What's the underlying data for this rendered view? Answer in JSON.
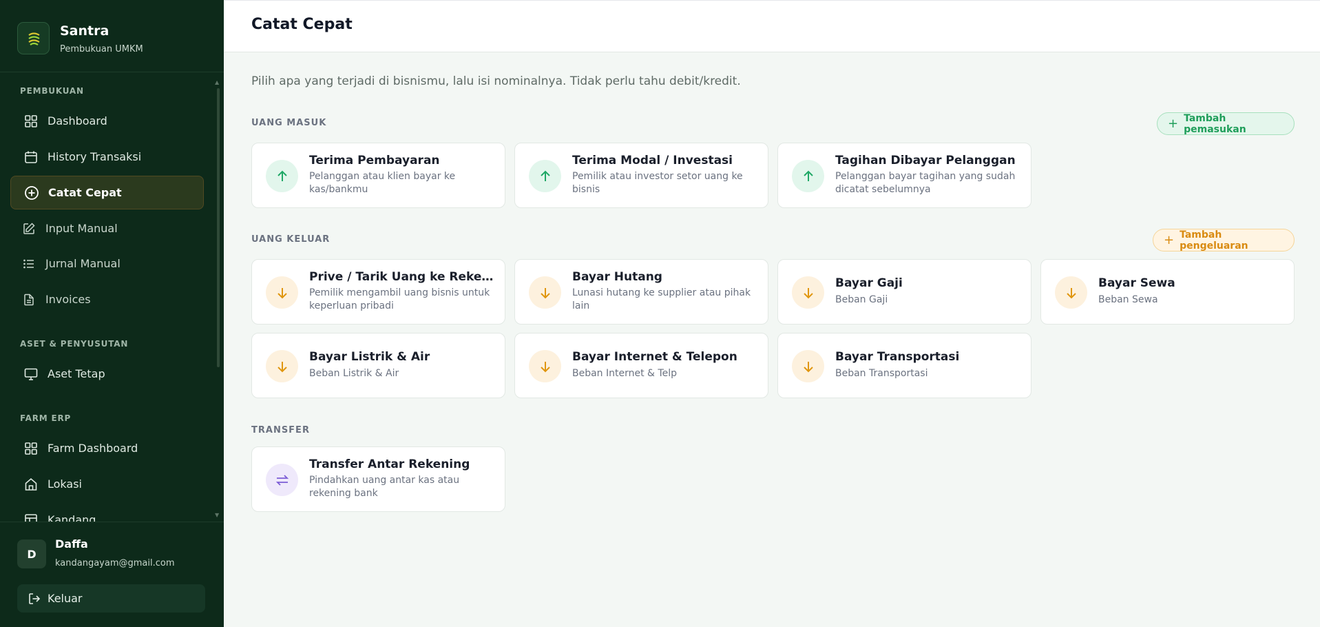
{
  "brand": {
    "name": "Santra",
    "subtitle": "Pembukuan UMKM"
  },
  "sidebar": {
    "sections": [
      {
        "label": "PEMBUKUAN"
      },
      {
        "label": "ASET & PENYUSUTAN"
      },
      {
        "label": "FARM ERP"
      }
    ],
    "items": [
      {
        "label": "Dashboard",
        "icon": "grid-icon"
      },
      {
        "label": "History Transaksi",
        "icon": "calendar-icon"
      },
      {
        "label": "Catat Cepat",
        "icon": "plus-circle-icon",
        "active": true
      },
      {
        "label": "Input Manual",
        "icon": "edit-icon"
      },
      {
        "label": "Jurnal Manual",
        "icon": "list-icon"
      },
      {
        "label": "Invoices",
        "icon": "file-icon"
      },
      {
        "label": "Aset Tetap",
        "icon": "monitor-icon"
      },
      {
        "label": "Farm Dashboard",
        "icon": "grid-icon"
      },
      {
        "label": "Lokasi",
        "icon": "home-icon"
      },
      {
        "label": "Kandang",
        "icon": "layout-icon"
      }
    ]
  },
  "user": {
    "initial": "D",
    "name": "Daffa",
    "email": "kandangayam@gmail.com",
    "logout_label": "Keluar"
  },
  "header": {
    "title": "Catat Cepat"
  },
  "intro": "Pilih apa yang terjadi di bisnismu, lalu isi nominalnya. Tidak perlu tahu debit/kredit.",
  "sections": {
    "masuk": {
      "label": "UANG MASUK",
      "button": "Tambah pemasukan",
      "cards": [
        {
          "title": "Terima Pembayaran",
          "desc": "Pelanggan atau klien bayar ke kas/bankmu"
        },
        {
          "title": "Terima Modal / Investasi",
          "desc": "Pemilik atau investor setor uang ke bisnis"
        },
        {
          "title": "Tagihan Dibayar Pelanggan",
          "desc": "Pelanggan bayar tagihan yang sudah dicatat sebelumnya"
        }
      ]
    },
    "keluar": {
      "label": "UANG KELUAR",
      "button": "Tambah pengeluaran",
      "cards": [
        {
          "title": "Prive / Tarik Uang ke Rekening Pribadi",
          "desc": "Pemilik mengambil uang bisnis untuk keperluan pribadi"
        },
        {
          "title": "Bayar Hutang",
          "desc": "Lunasi hutang ke supplier atau pihak lain"
        },
        {
          "title": "Bayar Gaji",
          "desc": "Beban Gaji"
        },
        {
          "title": "Bayar Sewa",
          "desc": "Beban Sewa"
        },
        {
          "title": "Bayar Listrik & Air",
          "desc": "Beban Listrik & Air"
        },
        {
          "title": "Bayar Internet & Telepon",
          "desc": "Beban Internet & Telp"
        },
        {
          "title": "Bayar Transportasi",
          "desc": "Beban Transportasi"
        }
      ]
    },
    "transfer": {
      "label": "TRANSFER",
      "cards": [
        {
          "title": "Transfer Antar Rekening",
          "desc": "Pindahkan uang antar kas atau rekening bank"
        }
      ]
    }
  },
  "colors": {
    "sidebar_bg": "#0d2a1a",
    "accent_green": "#1f9e5a",
    "accent_amber": "#d98b12",
    "accent_purple": "#7c5cd6"
  }
}
